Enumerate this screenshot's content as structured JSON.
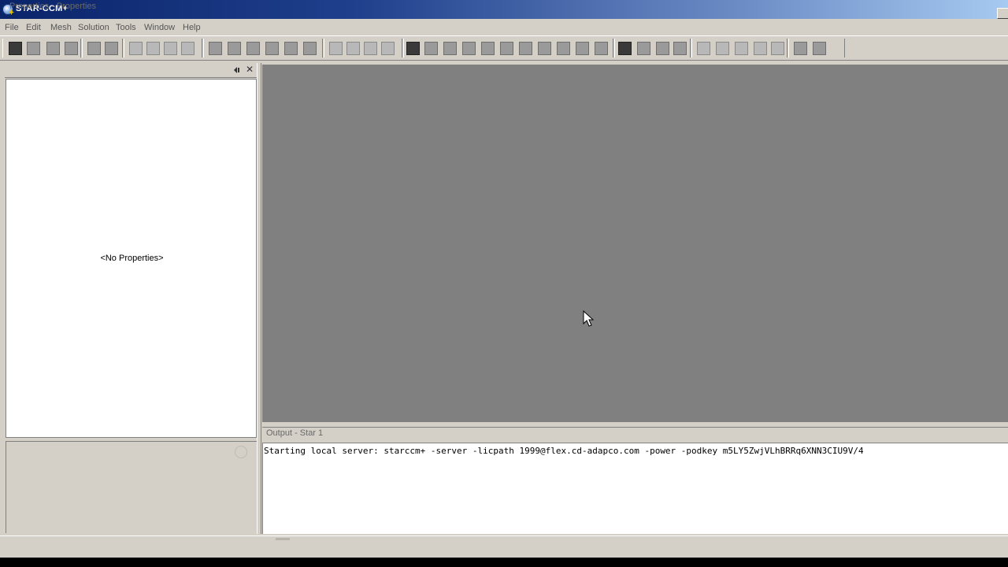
{
  "window": {
    "title": "STAR-CCM+"
  },
  "menu": [
    "File",
    "Edit",
    "Mesh",
    "Solution",
    "Tools",
    "Window",
    "Help"
  ],
  "properties_panel": {
    "title": "Properties - Properties",
    "empty_text": "<No Properties>"
  },
  "output_panel": {
    "title": "Output - Star 1",
    "lines": [
      "Starting local server: starccm+ -server -licpath 1999@flex.cd-adapco.com -power -podkey m5LY5ZwjVLhBRRq6XNN3CIU9V/4"
    ]
  },
  "colors": {
    "titlebar_start": "#0a246a",
    "titlebar_end": "#a6caf0",
    "chrome": "#d4d0c8",
    "graphics_background": "#808080",
    "panel_background": "#ffffff"
  },
  "icons": {
    "app": "star-ccm-globe-icon",
    "cursor": "mouse-pointer-icon"
  }
}
